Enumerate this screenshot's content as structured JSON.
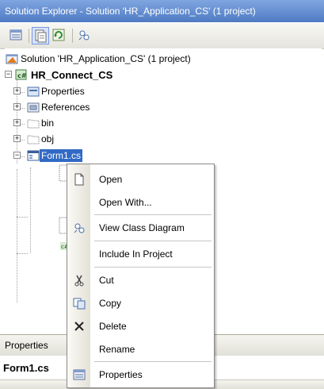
{
  "window": {
    "title": "Solution Explorer - Solution 'HR_Application_CS' (1 project)"
  },
  "toolbar": {
    "buttons": [
      {
        "icon": "properties-icon"
      },
      {
        "icon": "show-all-files-icon"
      },
      {
        "icon": "refresh-icon"
      },
      {
        "icon": "view-class-diagram-icon"
      }
    ]
  },
  "tree": {
    "solution": "Solution 'HR_Application_CS' (1 project)",
    "project": "HR_Connect_CS",
    "items": [
      {
        "label": "Properties",
        "icon": "properties-folder-icon",
        "expander": "+"
      },
      {
        "label": "References",
        "icon": "references-folder-icon",
        "expander": "+"
      },
      {
        "label": "bin",
        "icon": "folder-icon",
        "expander": "+"
      },
      {
        "label": "obj",
        "icon": "folder-icon",
        "expander": "+"
      },
      {
        "label": "Form1.cs",
        "icon": "form-icon",
        "expander": "−"
      }
    ]
  },
  "context_menu": {
    "items": [
      {
        "label": "Open",
        "icon": "document-icon"
      },
      {
        "label": "Open With...",
        "icon": ""
      },
      {
        "label": "View Class Diagram",
        "icon": "class-diagram-icon"
      },
      {
        "label": "Include In Project",
        "icon": ""
      },
      {
        "label": "Cut",
        "icon": "scissors-icon"
      },
      {
        "label": "Copy",
        "icon": "copy-icon"
      },
      {
        "label": "Delete",
        "icon": "delete-icon"
      },
      {
        "label": "Rename",
        "icon": ""
      },
      {
        "label": "Properties",
        "icon": "properties-icon"
      }
    ]
  },
  "properties_panel": {
    "title": "Properties",
    "object": "Form1.cs"
  },
  "colors": {
    "selection": "#316ac5",
    "title_bar": "#4f7bc4"
  }
}
